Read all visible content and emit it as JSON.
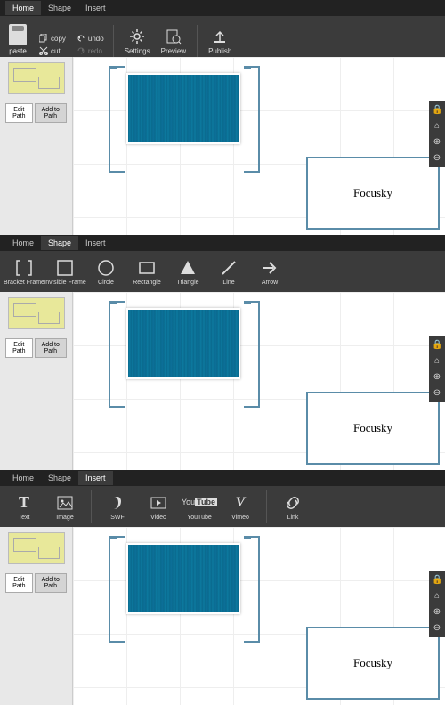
{
  "tabs": {
    "home": "Home",
    "shape": "Shape",
    "insert": "Insert"
  },
  "home": {
    "paste": "paste",
    "copy": "copy",
    "cut": "cut",
    "undo": "undo",
    "redo": "redo",
    "settings": "Settings",
    "preview": "Preview",
    "publish": "Publish"
  },
  "shape": {
    "bracket": "Bracket Frame",
    "invisible": "Invisible Frame",
    "circle": "Circle",
    "rectangle": "Rectangle",
    "triangle": "Triangle",
    "line": "Line",
    "arrow": "Arrow"
  },
  "insert": {
    "text": "Text",
    "image": "Image",
    "swf": "SWF",
    "video": "Video",
    "youtube": "YouTube",
    "vimeo": "Vimeo",
    "link": "Link"
  },
  "sidebar": {
    "editPath": "Edit Path",
    "addToPath": "Add to Path"
  },
  "canvas": {
    "watermark": "Focusky"
  }
}
